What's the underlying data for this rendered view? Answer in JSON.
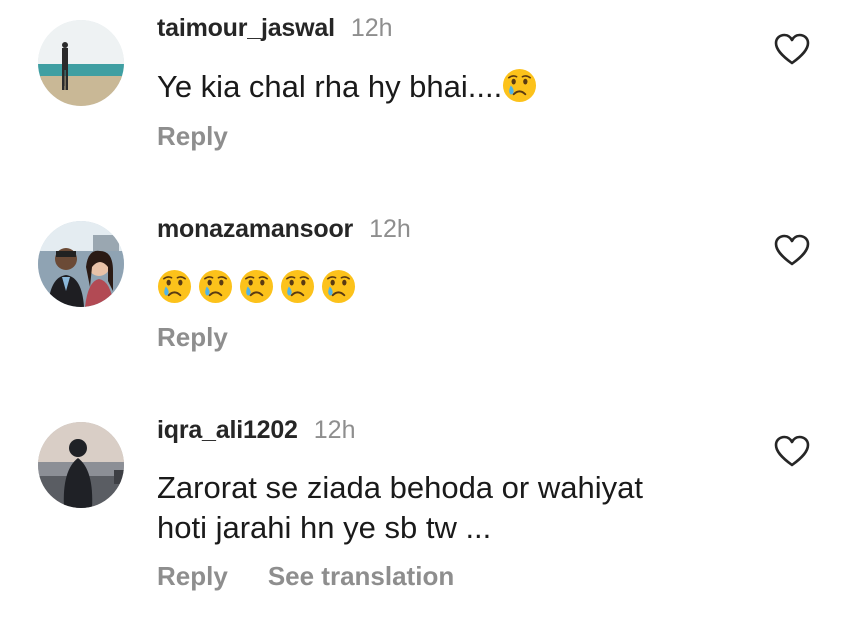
{
  "comments": [
    {
      "username": "taimour_jaswal",
      "time": "12h",
      "text": "Ye kia chal rha hy bhai....",
      "emoji": "crying-face",
      "actions": [
        "Reply"
      ]
    },
    {
      "username": "monazamansoor",
      "time": "12h",
      "text": "",
      "emoji_count": 5,
      "emoji": "crying-face",
      "actions": [
        "Reply"
      ]
    },
    {
      "username": "iqra_ali1202",
      "time": "12h",
      "text_line1": "Zarorat se ziada behoda or wahiyat",
      "text_line2": "hoti jarahi hn ye sb tw ...",
      "actions": [
        "Reply",
        "See translation"
      ]
    }
  ],
  "icons": {
    "like": "heart-outline-icon",
    "emoji": "crying-face-emoji"
  },
  "colors": {
    "username": "#262626",
    "muted": "#8e8e8e",
    "emoji_yellow": "#fcc21b",
    "tear_blue": "#4fb3e8"
  }
}
